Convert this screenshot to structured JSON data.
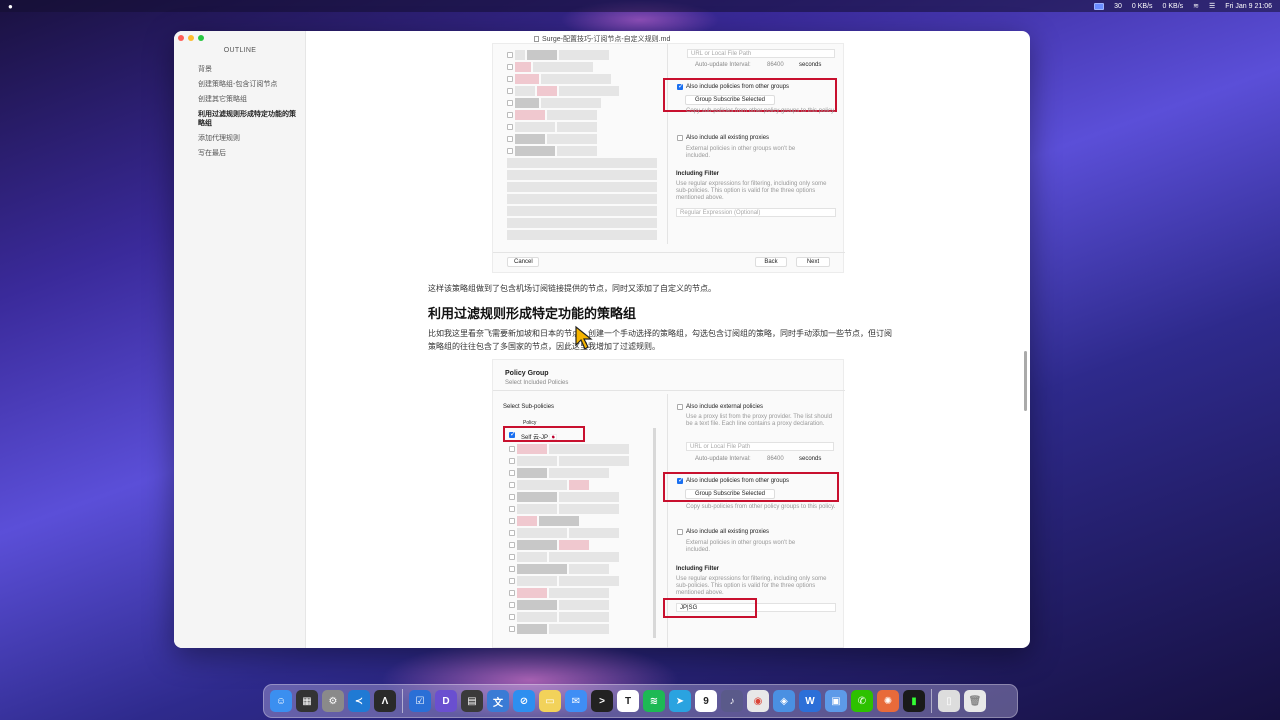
{
  "menubar": {
    "apple": "",
    "items_right": [
      "30",
      "0 KB/s",
      "0 KB/s"
    ],
    "datetime": "Fri Jan 9  21:06"
  },
  "window": {
    "doc_title": "Surge-配置技巧-订阅节点-自定义规则.md",
    "outline_title": "OUTLINE",
    "outline": [
      {
        "label": "背景",
        "active": false
      },
      {
        "label": "创建策略组-包含订阅节点",
        "active": false
      },
      {
        "label": "创建其它策略组",
        "active": false
      },
      {
        "label": "利用过滤规则形成特定功能的策略组",
        "active": true
      },
      {
        "label": "添加代理规则",
        "active": false
      },
      {
        "label": "写在最后",
        "active": false
      }
    ]
  },
  "shot1": {
    "url_placeholder": "URL or Local File Path",
    "auto_update": "Auto-update Interval:",
    "interval_value": "86400",
    "seconds": "seconds",
    "include_groups": "Also include policies from other groups",
    "group_subscribe": "Group Subscribe Selected",
    "include_groups_desc": "Copy sub-policies from other policy groups to this policy.",
    "include_all": "Also include all existing proxies",
    "include_all_desc": "External policies in other groups won't be included.",
    "filter_title": "Including Filter",
    "filter_desc": "Use regular expressions for filtering, including only some sub-policies. This option is valid for the three options mentioned above.",
    "filter_placeholder": "Regular Expression (Optional)",
    "cancel": "Cancel",
    "back": "Back",
    "next": "Next"
  },
  "paragraph1": "这样该策略组做到了包含机场订阅链接提供的节点，同时又添加了自定义的节点。",
  "heading": "利用过滤规则形成特定功能的策略组",
  "paragraph2_line1": "比如我这里看奈飞需要新加坡和日本的节点，创建一个手动选择的策略组，勾选包含订阅组的策略，同时手动添加一些节点，但订阅",
  "paragraph2_line2": "策略组的往往包含了多国家的节点，因此这里我增加了过滤规则。",
  "shot2": {
    "title": "Policy Group",
    "subtitle": "Select Included Policies",
    "select_sub": "Select Sub-policies",
    "policy_header": "Policy",
    "first_policy": "Self 云-JP 🇯🇵",
    "include_external": "Also include external policies",
    "include_external_desc": "Use a proxy list from the proxy provider. The list should be a text file. Each line contains a proxy declaration.",
    "url_placeholder": "URL or Local File Path",
    "auto_update": "Auto-update Interval:",
    "interval_value": "86400",
    "seconds": "seconds",
    "include_groups": "Also include policies from other groups",
    "group_subscribe": "Group Subscribe Selected",
    "include_groups_desc": "Copy sub-policies from other policy groups to this policy.",
    "include_all": "Also include all existing proxies",
    "include_all_desc": "External policies in other groups won't be included.",
    "filter_title": "Including Filter",
    "filter_desc": "Use regular expressions for filtering, including only some sub-policies. This option is valid for the three options mentioned above.",
    "filter_value": "JP|SG"
  },
  "dock": {
    "icons": [
      "finder-icon",
      "launchpad-icon",
      "settings-icon",
      "vscode-icon",
      "xcode-icon",
      "things-icon",
      "dash-icon",
      "notes-icon",
      "translate-icon",
      "safari-icon",
      "stickies-icon",
      "mail-icon",
      "terminal-icon",
      "typora-icon",
      "spotify-icon",
      "telegram-icon",
      "calendar-icon",
      "soundboard-icon",
      "chrome-icon",
      "surge-icon",
      "wps-icon",
      "finder2-icon",
      "wechat-icon",
      "sunflower-icon",
      "activity-icon",
      "preview-icon",
      "trash-icon"
    ],
    "calendar_day": "9",
    "typora_letter": "T"
  }
}
